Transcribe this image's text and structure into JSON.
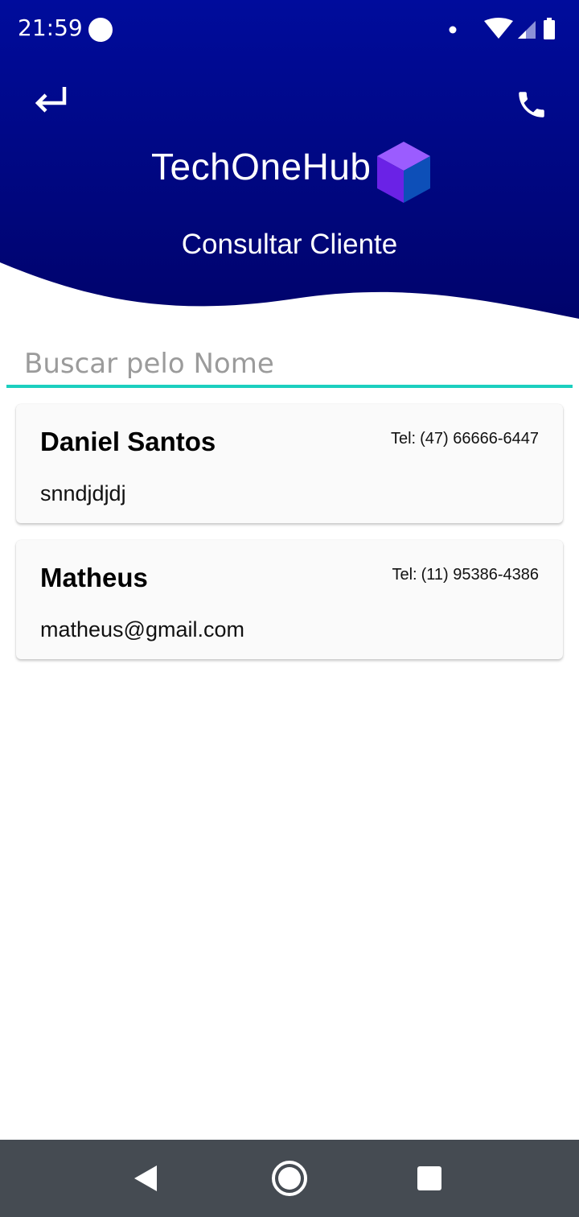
{
  "status_bar": {
    "time": "21:59"
  },
  "header": {
    "app_name": "TechOneHub",
    "page_title": "Consultar Cliente",
    "gradient_top": "#000c9c",
    "gradient_bottom": "#00036b"
  },
  "search": {
    "placeholder": "Buscar pelo Nome",
    "value": "",
    "accent_color": "#1ccfbf"
  },
  "clients": [
    {
      "name": "Daniel Santos",
      "phone_label": "Tel:",
      "phone": "(47) 66666-6447",
      "email": "snndjdjdj"
    },
    {
      "name": "Matheus",
      "phone_label": "Tel:",
      "phone": "(11) 95386-4386",
      "email": "matheus@gmail.com"
    }
  ],
  "icons": {
    "back": "return-arrow-icon",
    "call": "phone-icon",
    "logo": "cube-icon",
    "nav_back": "triangle-back-icon",
    "nav_home": "circle-home-icon",
    "nav_recent": "square-recents-icon"
  }
}
